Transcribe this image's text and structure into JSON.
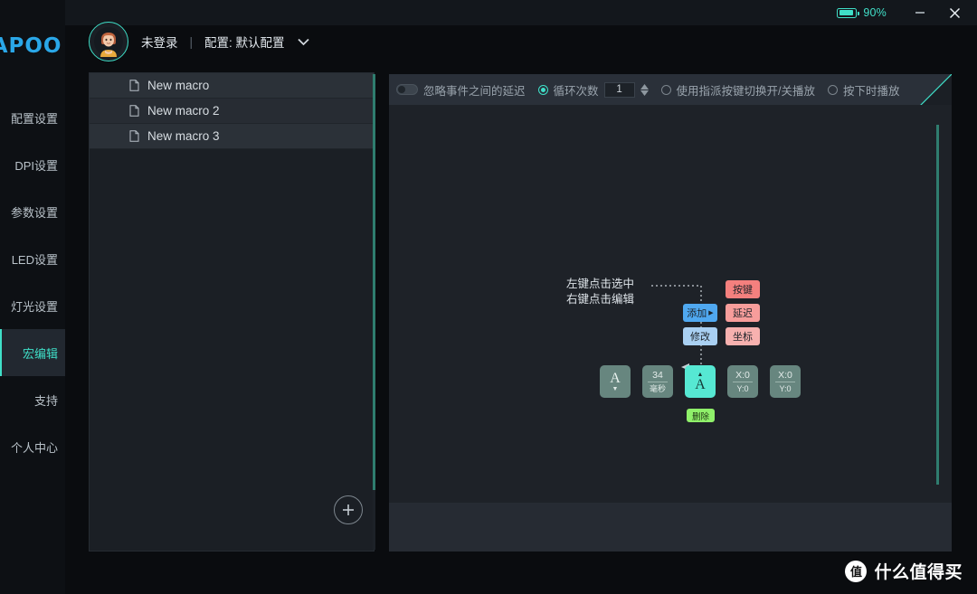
{
  "titlebar": {
    "battery_icon": "battery-icon",
    "battery_percent": "90%",
    "minimize_label": "minimize-icon",
    "close_label": "close-icon"
  },
  "brand": {
    "logo_text": "RAPOO",
    "logo_visible": "APOO"
  },
  "sidebar": {
    "items": [
      {
        "label": "配置设置",
        "name": "sidebar-item-profile-settings",
        "active": false
      },
      {
        "label": "DPI设置",
        "name": "sidebar-item-dpi-settings",
        "active": false
      },
      {
        "label": "参数设置",
        "name": "sidebar-item-parameter-settings",
        "active": false
      },
      {
        "label": "LED设置",
        "name": "sidebar-item-led-settings",
        "active": false
      },
      {
        "label": "灯光设置",
        "name": "sidebar-item-light-settings",
        "active": false
      },
      {
        "label": "宏编辑",
        "name": "sidebar-item-macro-edit",
        "active": true
      },
      {
        "label": "支持",
        "name": "sidebar-item-support",
        "active": false
      },
      {
        "label": "个人中心",
        "name": "sidebar-item-account",
        "active": false
      }
    ]
  },
  "header": {
    "login_status": "未登录",
    "divider": "|",
    "profile_label": "配置: 默认配置",
    "dropdown_icon": "chevron-down-icon"
  },
  "macro_list": {
    "items": [
      {
        "label": "New macro"
      },
      {
        "label": "New macro 2"
      },
      {
        "label": "New macro 3"
      }
    ],
    "add_button_icon": "plus-circle-icon"
  },
  "toolbar": {
    "ignore_delay_label": "忽略事件之间的延迟",
    "ignore_delay_on": false,
    "loop_count_label": "循环次数",
    "loop_count_value": "1",
    "loop_count_selected": true,
    "toggle_play_label": "使用指派按键切换开/关播放",
    "toggle_play_selected": false,
    "press_play_label": "按下时播放",
    "press_play_selected": false
  },
  "canvas": {
    "hint_line1": "左键点击选中",
    "hint_line2": "右键点击编辑",
    "context_menu": {
      "add_label": "添加",
      "add_arrow": "▶",
      "modify_label": "修改",
      "key_label": "按键",
      "delay_label": "延迟",
      "coord_label": "坐标"
    },
    "nodes": [
      {
        "type": "key-up",
        "main": "A",
        "sub": "▼",
        "selected": false
      },
      {
        "type": "delay",
        "main": "34",
        "sub": "毫秒",
        "selected": false
      },
      {
        "type": "key-down",
        "main": "A",
        "sub": "▲",
        "selected": true
      },
      {
        "type": "coord",
        "main": "X:0",
        "sub": "Y:0",
        "selected": false
      },
      {
        "type": "coord",
        "main": "X:0",
        "sub": "Y:0",
        "selected": false
      }
    ],
    "delete_label": "删除"
  },
  "watermark": {
    "badge": "值",
    "text": "什么值得买"
  },
  "colors": {
    "accent_teal": "#3fdfc8",
    "panel_bg": "#1b1f25",
    "canvas_bg": "#1e2228",
    "toolbar_bg": "#2a3039",
    "rail_bg": "#0d1014",
    "node_green": "#67867f",
    "node_selected": "#56e8d3",
    "delete_green": "#8ff06a",
    "ctx_blue": "#4fa8f0",
    "ctx_red": "#f4807e"
  }
}
